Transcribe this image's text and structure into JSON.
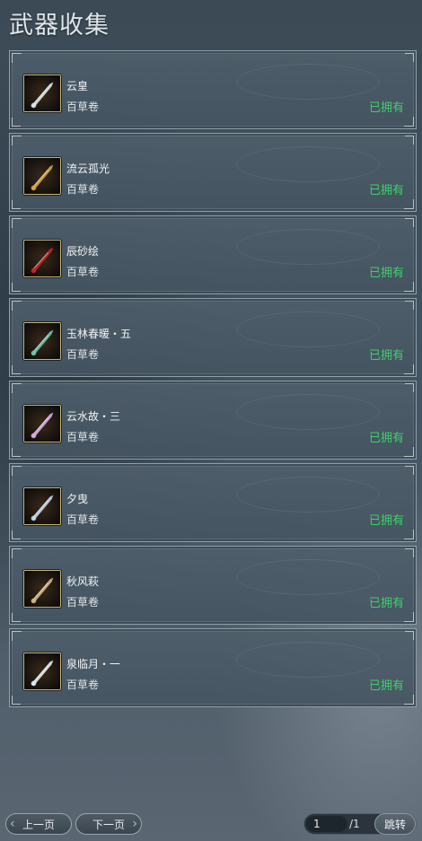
{
  "header": {
    "title": "武器收集"
  },
  "weapons": [
    {
      "name": "云皇",
      "source": "百草卷",
      "status": "已拥有",
      "icon": "fan-weapon-icon",
      "accent": "#e0e8ea"
    },
    {
      "name": "流云孤光",
      "source": "百草卷",
      "status": "已拥有",
      "icon": "golden-blade-icon",
      "accent": "#d9a640"
    },
    {
      "name": "辰砂绘",
      "source": "百草卷",
      "status": "已拥有",
      "icon": "red-ribbon-blade-icon",
      "accent": "#c8262b"
    },
    {
      "name": "玉林春暖・五",
      "source": "百草卷",
      "status": "已拥有",
      "icon": "jade-ornate-blade-icon",
      "accent": "#6fc7b0"
    },
    {
      "name": "云水故・三",
      "source": "百草卷",
      "status": "已拥有",
      "icon": "flower-blade-icon",
      "accent": "#d7b0e6"
    },
    {
      "name": "夕曳",
      "source": "百草卷",
      "status": "已拥有",
      "icon": "feather-blade-icon",
      "accent": "#c8d8f0"
    },
    {
      "name": "秋风萩",
      "source": "百草卷",
      "status": "已拥有",
      "icon": "autumn-blade-icon",
      "accent": "#d5b880"
    },
    {
      "name": "泉临月・一",
      "source": "百草卷",
      "status": "已拥有",
      "icon": "silver-moon-blade-icon",
      "accent": "#e6eef4"
    }
  ],
  "pagination": {
    "prev_label": "上一页",
    "next_label": "下一页",
    "current_page": "1",
    "total_pages": "/1",
    "jump_label": "跳转"
  },
  "colors": {
    "owned": "#3ed06a",
    "frame": "#c7b27a"
  }
}
